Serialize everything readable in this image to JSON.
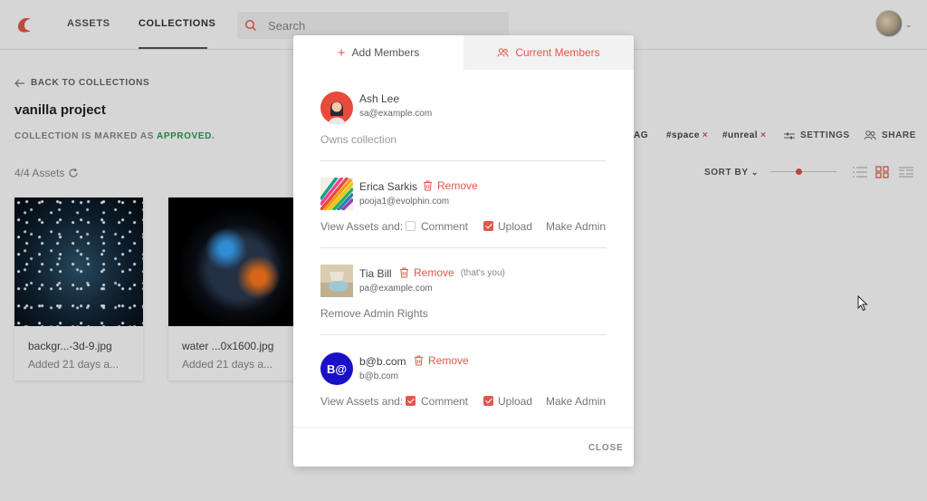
{
  "topbar": {
    "tabs": [
      {
        "label": "ASSETS"
      },
      {
        "label": "COLLECTIONS",
        "active": true
      }
    ],
    "search_placeholder": "Search",
    "icons": {
      "logo": "bird-logo-icon",
      "search": "search-icon",
      "avatar_menu": "chevron-down-icon"
    }
  },
  "page": {
    "back_label": "BACK TO COLLECTIONS",
    "title": "vanilla project",
    "approved_prefix": "COLLECTION IS MARKED AS",
    "approved_word": "APPROVED.",
    "asset_count": "4/4 Assets",
    "tag_partial": "AG",
    "tags": [
      "#space",
      "#unreal"
    ],
    "settings_label": "SETTINGS",
    "share_label": "SHARE",
    "sort_label": "SORT BY",
    "zoom_level": 0.42,
    "assets": [
      {
        "name": "backgr...-3d-9.jpg",
        "meta": "Added 21 days a..."
      },
      {
        "name": "water ...0x1600.jpg",
        "meta": "Added 21 days a..."
      }
    ]
  },
  "modal": {
    "tab_add": "Add Members",
    "tab_current": "Current Members",
    "active_tab": "Current Members",
    "owner": {
      "name": "Ash Lee",
      "email": "sa@example.com",
      "role_text": "Owns collection"
    },
    "members": [
      {
        "name": "Erica Sarkis",
        "email": "pooja1@evolphin.com",
        "remove_label": "Remove",
        "perm_label": "View Assets and:",
        "comment_label": "Comment",
        "comment_checked": false,
        "upload_label": "Upload",
        "upload_checked": true,
        "admin_label": "Make Admin"
      },
      {
        "name": "Tia Bill",
        "email": "pa@example.com",
        "remove_label": "Remove",
        "note": "(that's you)",
        "admin_action": "Remove Admin Rights"
      },
      {
        "name": "b@b.com",
        "email": "b@b.com",
        "initials": "B@",
        "remove_label": "Remove",
        "perm_label": "View Assets and:",
        "comment_label": "Comment",
        "comment_checked": true,
        "upload_label": "Upload",
        "upload_checked": true,
        "admin_label": "Make Admin"
      }
    ],
    "close_label": "CLOSE"
  },
  "colors": {
    "accent": "#e2574c",
    "approved": "#2e9b4f",
    "initials_bg": "#1a10c8"
  }
}
